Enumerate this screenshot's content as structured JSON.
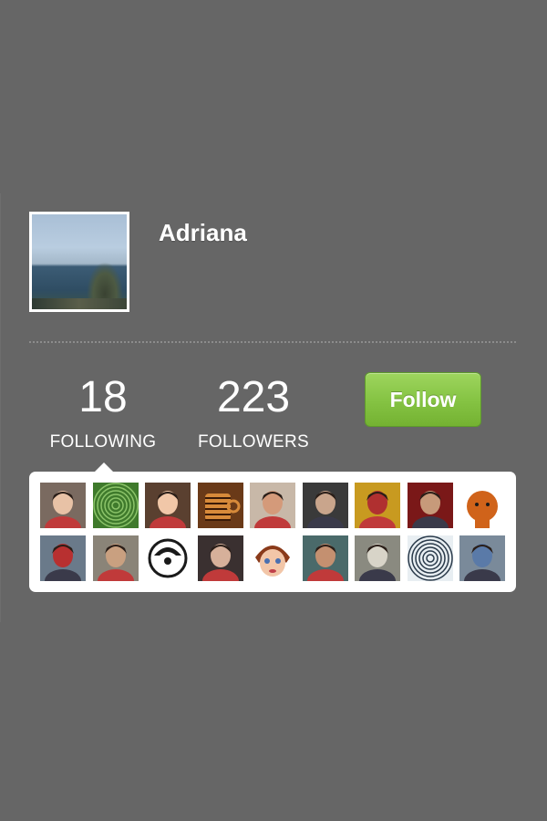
{
  "profile": {
    "name": "Adriana"
  },
  "stats": {
    "following_count": "18",
    "following_label": "FOLLOWING",
    "followers_count": "223",
    "followers_label": "FOLLOWERS"
  },
  "actions": {
    "follow_label": "Follow"
  },
  "colors": {
    "background": "#666666",
    "follow_button": "#86c444",
    "text": "#ffffff"
  },
  "following_thumbnails": [
    {
      "name": "thumb-person-smiling-woman",
      "bg": "#7a6a60",
      "fg": "#e8c2a6"
    },
    {
      "name": "thumb-green-spiral-pattern",
      "bg": "#3f7a2c",
      "fg": "#8cc46a"
    },
    {
      "name": "thumb-person-woman-brown-hair",
      "bg": "#5a4030",
      "fg": "#f1c7a8"
    },
    {
      "name": "thumb-coffee-mug",
      "bg": "#6a3a18",
      "fg": "#d78a3a"
    },
    {
      "name": "thumb-person-man-pink-shirt",
      "bg": "#c8b8a8",
      "fg": "#d49a7a"
    },
    {
      "name": "thumb-person-man-gray-hair",
      "bg": "#3a3a3a",
      "fg": "#c9a58c"
    },
    {
      "name": "thumb-person-woman-autumn",
      "bg": "#c89a20",
      "fg": "#b03030"
    },
    {
      "name": "thumb-person-man-headphones",
      "bg": "#7a1818",
      "fg": "#c79a7a"
    },
    {
      "name": "thumb-cartoon-orange-creature",
      "bg": "#ffffff",
      "fg": "#d0631a"
    },
    {
      "name": "thumb-person-woman-red-top",
      "bg": "#6a7a8a",
      "fg": "#b83030"
    },
    {
      "name": "thumb-person-man-beard",
      "bg": "#8a8478",
      "fg": "#c9a080"
    },
    {
      "name": "thumb-cartoon-black-white-logo",
      "bg": "#ffffff",
      "fg": "#1a1a1a"
    },
    {
      "name": "thumb-person-woman-glasses",
      "bg": "#3a3030",
      "fg": "#d6b09a"
    },
    {
      "name": "thumb-cartoon-girl-face",
      "bg": "#ffffff",
      "fg": "#f2c6a8"
    },
    {
      "name": "thumb-person-woman-dark-hair",
      "bg": "#4a6a6a",
      "fg": "#c49070"
    },
    {
      "name": "thumb-otter-animal",
      "bg": "#8a8a80",
      "fg": "#d8d4c8"
    },
    {
      "name": "thumb-bw-spiral-pattern",
      "bg": "#e8eef2",
      "fg": "#2a3a4a"
    },
    {
      "name": "thumb-group-photo",
      "bg": "#7a8a9a",
      "fg": "#5a7aa8"
    }
  ]
}
